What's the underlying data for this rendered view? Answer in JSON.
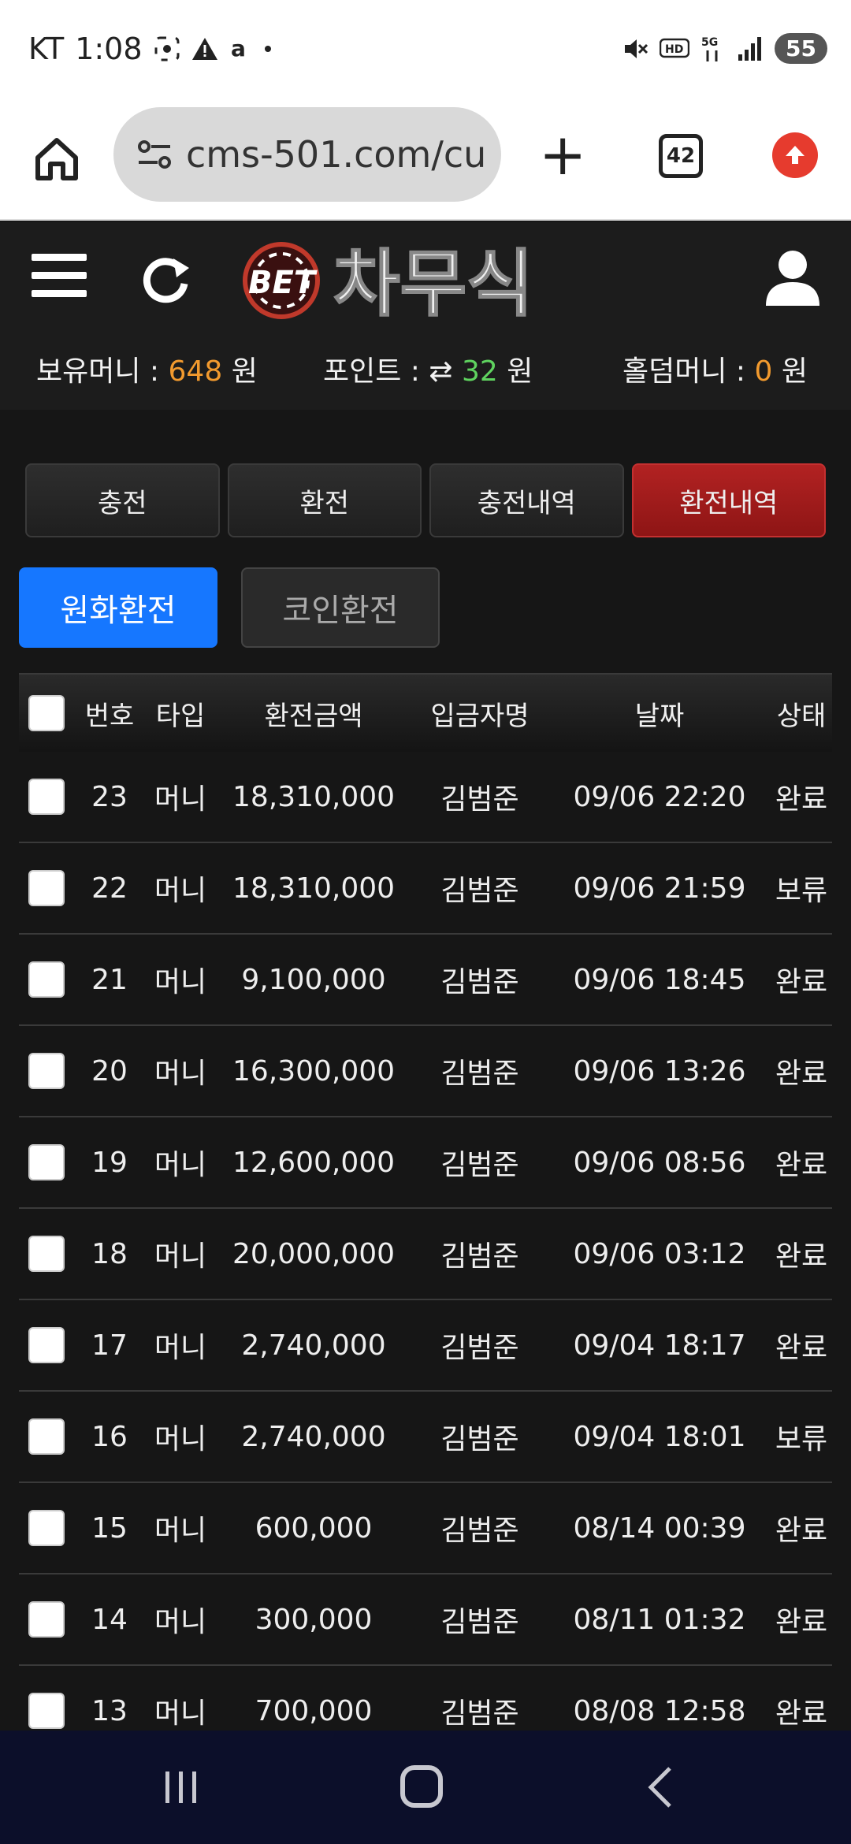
{
  "status_bar": {
    "carrier": "KT",
    "time": "1:08",
    "battery": "55"
  },
  "browser": {
    "url": "cms-501.com/cus",
    "tab_count": "42"
  },
  "header": {
    "logo_prefix": "BET",
    "logo_text": "차무식"
  },
  "balances": {
    "money_label": "보유머니 :",
    "money_value": "648",
    "money_unit": "원",
    "point_label": "포인트 :",
    "point_value": "32",
    "point_unit": "원",
    "holdem_label": "홀덤머니 :",
    "holdem_value": "0",
    "holdem_unit": "원"
  },
  "tabs": [
    "충전",
    "환전",
    "충전내역",
    "환전내역"
  ],
  "active_tab": "환전내역",
  "subtabs": {
    "won": "원화환전",
    "coin": "코인환전"
  },
  "table": {
    "headers": [
      "번호",
      "타입",
      "환전금액",
      "입금자명",
      "날짜",
      "상태"
    ],
    "rows": [
      [
        "23",
        "머니",
        "18,310,000",
        "김범준",
        "09/06 22:20",
        "완료"
      ],
      [
        "22",
        "머니",
        "18,310,000",
        "김범준",
        "09/06 21:59",
        "보류"
      ],
      [
        "21",
        "머니",
        "9,100,000",
        "김범준",
        "09/06 18:45",
        "완료"
      ],
      [
        "20",
        "머니",
        "16,300,000",
        "김범준",
        "09/06 13:26",
        "완료"
      ],
      [
        "19",
        "머니",
        "12,600,000",
        "김범준",
        "09/06 08:56",
        "완료"
      ],
      [
        "18",
        "머니",
        "20,000,000",
        "김범준",
        "09/06 03:12",
        "완료"
      ],
      [
        "17",
        "머니",
        "2,740,000",
        "김범준",
        "09/04 18:17",
        "완료"
      ],
      [
        "16",
        "머니",
        "2,740,000",
        "김범준",
        "09/04 18:01",
        "보류"
      ],
      [
        "15",
        "머니",
        "600,000",
        "김범준",
        "08/14 00:39",
        "완료"
      ],
      [
        "14",
        "머니",
        "300,000",
        "김범준",
        "08/11 01:32",
        "완료"
      ],
      [
        "13",
        "머니",
        "700,000",
        "김범준",
        "08/08 12:58",
        "완료"
      ]
    ]
  },
  "colors": {
    "accent_blue": "#1677ff",
    "active_red": "#a81c1c",
    "money_orange": "#f29a2e",
    "point_green": "#5fd35f"
  }
}
